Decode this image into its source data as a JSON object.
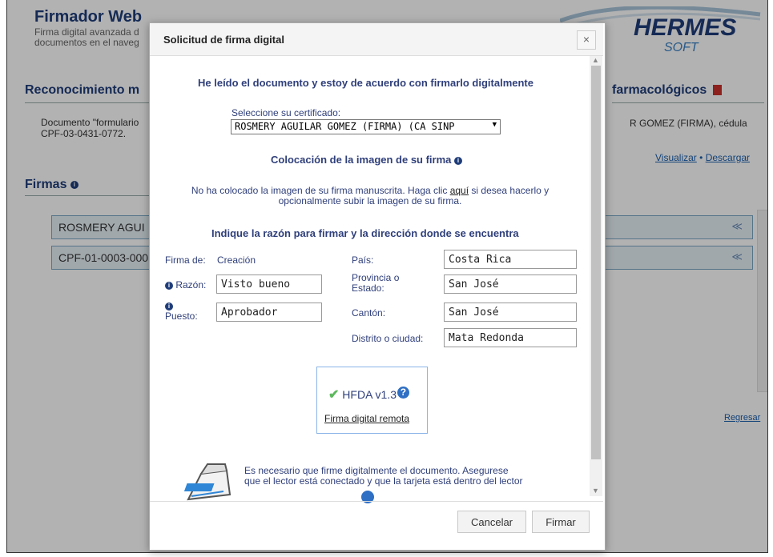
{
  "background": {
    "app_title": "Firmador Web",
    "app_subtitle": "Firma digital avanzada d documentos en el naveg",
    "logo_text": "HERMES",
    "logo_sub": "SOFT",
    "section_title_left": "Reconocimiento m",
    "section_title_right": "farmacológicos",
    "doc_line_left": "Documento \"formulario CPF-03-0431-0772.",
    "doc_line_right": "R GOMEZ (FIRMA), cédula",
    "visualize_link": "Visualizar",
    "link_sep": "•",
    "download_link": "Descargar",
    "firmas_title": "Firmas",
    "accordion_items": [
      "ROSMERY AGUI",
      "CPF-01-0003-000"
    ],
    "return_link": "Regresar"
  },
  "dialog": {
    "title": "Solicitud de firma digital",
    "close": "×",
    "agreement_heading": "He leído el documento y estoy de acuerdo con firmarlo digitalmente",
    "cert_label": "Seleccione su certificado:",
    "cert_value": "ROSMERY AGUILAR GOMEZ (FIRMA) (CA SINP",
    "image_heading": "Colocación de la imagen de su firma",
    "image_text_1": "No ha colocado la imagen de su firma manuscrita. Haga clic",
    "image_link": "aquí",
    "image_text_2": "si desea hacerlo y",
    "image_text_3": "opcionalmente subir la imagen de su firma.",
    "reason_heading": "Indique la razón para firmar y la dirección donde se encuentra",
    "firma_de_label": "Firma de:",
    "firma_de_value": "Creación",
    "razon_label": "Razón:",
    "razon_value": "Visto bueno",
    "puesto_label": "Puesto:",
    "puesto_value": "Aprobador",
    "pais_label": "País:",
    "pais_value": "Costa Rica",
    "provincia_label_1": "Provincia o",
    "provincia_label_2": "Estado:",
    "provincia_value": "San José",
    "canton_label": "Cantón:",
    "canton_value": "San José",
    "distrito_label": "Distrito o ciudad:",
    "distrito_value": "Mata Redonda",
    "hfda_label": "HFDA v1.3",
    "remote_link": "Firma digital remota",
    "reader_text_1": "Es necesario que firme digitalmente el documento. Asegurese",
    "reader_text_2": "que el lector está conectado y que la tarjeta está dentro del lector",
    "cancel_button": "Cancelar",
    "sign_button": "Firmar"
  },
  "colors": {
    "heading_blue": "#2f3f7a",
    "link_blue": "#1a5fae",
    "accordion_bg": "#e7f1f7",
    "check_green": "#5cb85c"
  }
}
